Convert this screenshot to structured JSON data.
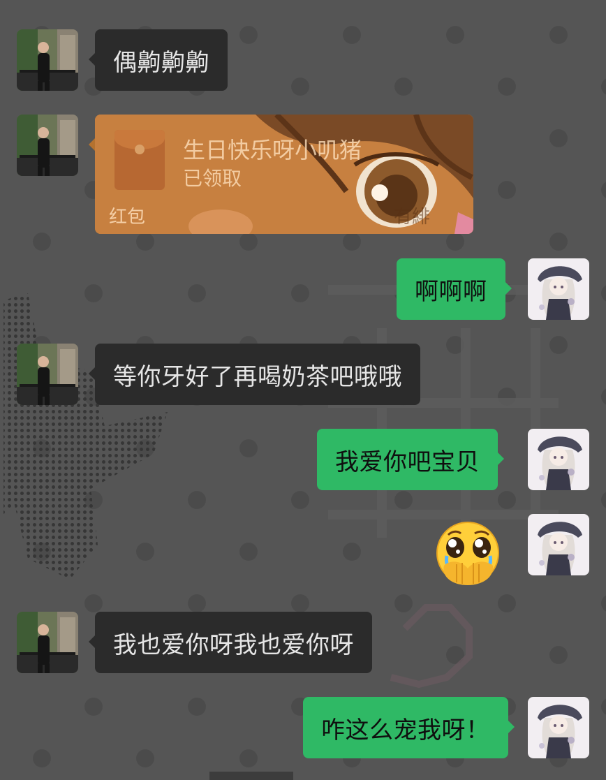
{
  "conversation": {
    "messages": [
      {
        "side": "incoming",
        "type": "text",
        "text": "偶齁齁齁"
      },
      {
        "side": "incoming",
        "type": "red_packet",
        "title": "生日快乐呀小叽猪",
        "status": "已领取",
        "label": "红包",
        "watermark": "有緋"
      },
      {
        "side": "outgoing",
        "type": "text",
        "text": "啊啊啊"
      },
      {
        "side": "incoming",
        "type": "text",
        "text": "等你牙好了再喝奶茶吧哦哦"
      },
      {
        "side": "outgoing",
        "type": "text",
        "text": "我爱你吧宝贝"
      },
      {
        "side": "outgoing",
        "type": "emoji",
        "emoji_name": "pleading-face-hands-over-mouth"
      },
      {
        "side": "incoming",
        "type": "text",
        "text": "我也爱你呀我也爱你呀"
      },
      {
        "side": "outgoing",
        "type": "text",
        "text": "咋这么宠我呀！"
      }
    ]
  },
  "avatars": {
    "contact": "contact-avatar-photo",
    "self": "anime-girl-avatar"
  },
  "theme": {
    "background": "#555555",
    "incoming_bubble": "#2b2b2b",
    "outgoing_bubble": "#2fb965",
    "red_packet": "#c07a33"
  }
}
